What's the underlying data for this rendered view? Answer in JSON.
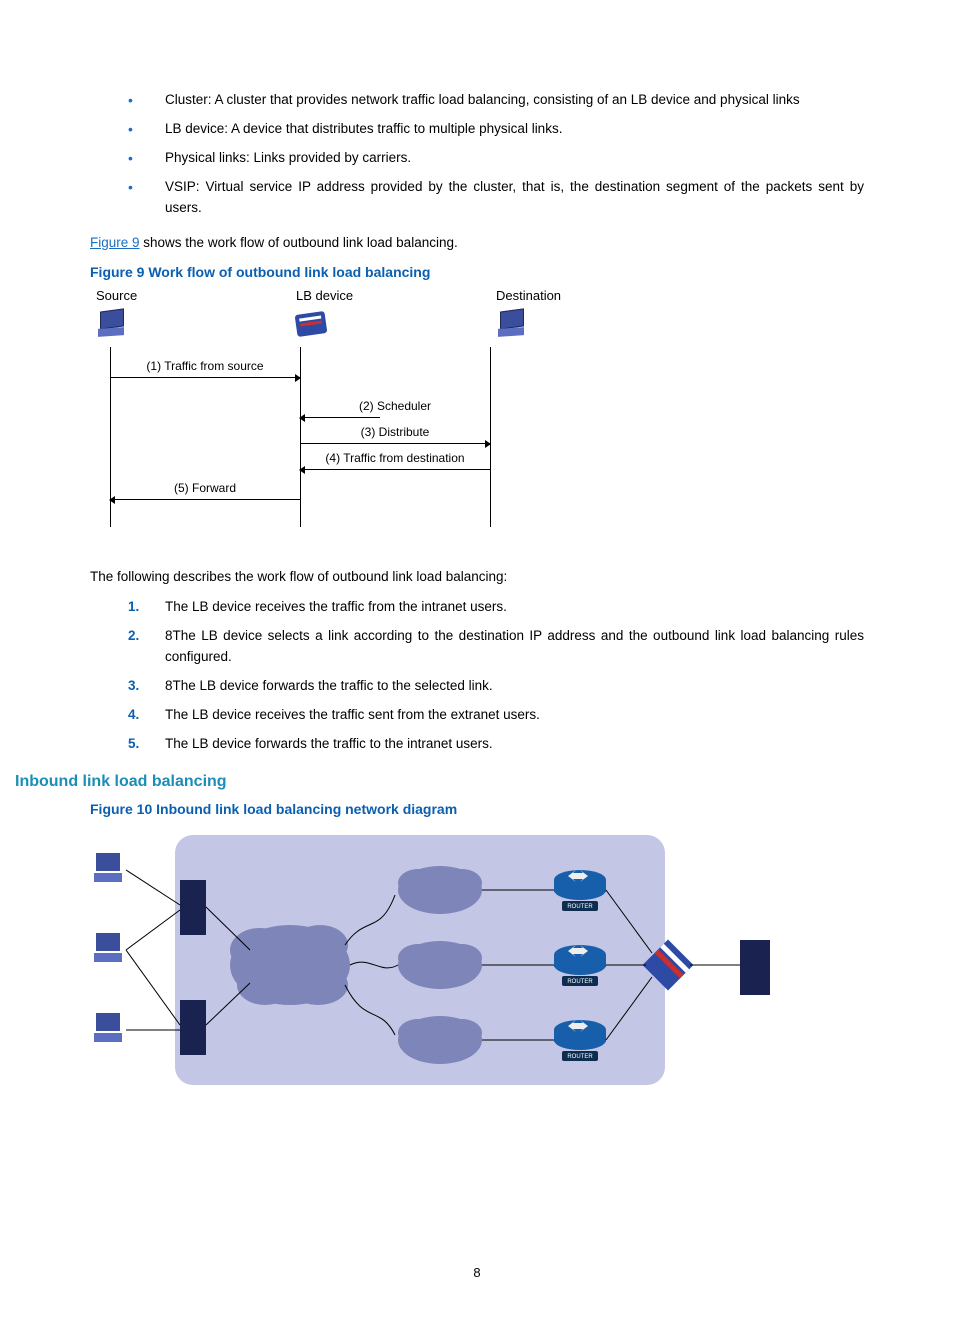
{
  "bullets": [
    "Cluster: A cluster that provides network traffic load balancing, consisting of an LB device and physical links",
    "LB device: A device that distributes traffic to multiple physical links.",
    "Physical links: Links provided by carriers.",
    "VSIP: Virtual service IP address provided by the cluster, that is, the destination segment of the packets sent by users."
  ],
  "para1_link": "Figure 9",
  "para1_rest": " shows the work flow of outbound link load balancing.",
  "fig9_caption": "Figure 9 Work flow of outbound link load balancing",
  "fig9": {
    "cols": {
      "c1": "Source",
      "c2": "LB device",
      "c3": "Destination"
    },
    "msgs": {
      "m1": "(1) Traffic from source",
      "m2": "(2) Scheduler",
      "m3": "(3) Distribute",
      "m4": "(4) Traffic from destination",
      "m5": "(5) Forward"
    }
  },
  "para2": "The following describes the work flow of outbound link load balancing:",
  "steps": [
    "The LB device receives the traffic from the intranet users.",
    "8The LB device selects a link according to the destination IP address and the outbound link load balancing rules configured.",
    "8The LB device forwards the traffic to the selected link.",
    "The LB device receives the traffic sent from the extranet users.",
    "The LB device forwards the traffic to the intranet users."
  ],
  "section_heading": "Inbound link load balancing",
  "fig10_caption": "Figure 10 Inbound link load balancing network diagram",
  "fig10_router_label": "ROUTER",
  "page_number": "8"
}
